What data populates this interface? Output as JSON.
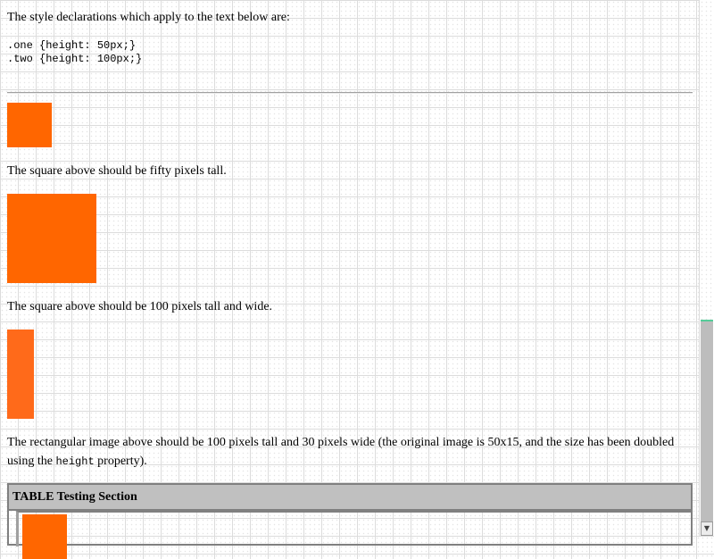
{
  "intro_text": "The style declarations which apply to the text below are:",
  "code_lines": {
    "line1": ".one {height: 50px;}",
    "line2": ".two {height: 100px;}"
  },
  "test1_text": "The square above should be fifty pixels tall.",
  "test2_text": "The square above should be 100 pixels tall and wide.",
  "test3": {
    "text_before": "The rectangular image above should be 100 pixels tall and 30 pixels wide (the original image is 50x15, and the size has been doubled using the ",
    "code": "height",
    "text_after": " property)."
  },
  "table_section": {
    "title": "TABLE Testing Section"
  },
  "colors": {
    "square": "#ff6600",
    "grid": "#dcdcdc"
  },
  "scrollbar": {
    "down_arrow_icon": "triangle-down"
  }
}
